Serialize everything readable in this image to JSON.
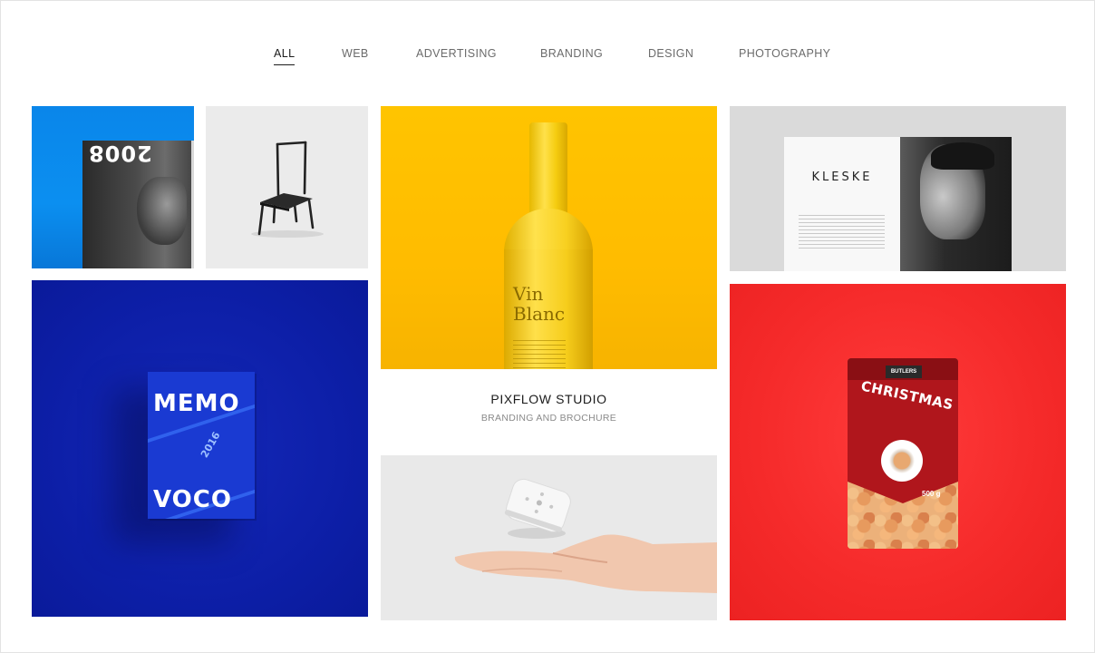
{
  "filters": [
    {
      "label": "ALL",
      "active": true
    },
    {
      "label": "WEB",
      "active": false
    },
    {
      "label": "ADVERTISING",
      "active": false
    },
    {
      "label": "BRANDING",
      "active": false
    },
    {
      "label": "DESIGN",
      "active": false
    },
    {
      "label": "PHOTOGRAPHY",
      "active": false
    }
  ],
  "portfolio": {
    "items": [
      {
        "image": "magazine-2008-cover",
        "cover_text": "2008"
      },
      {
        "image": "black-chair"
      },
      {
        "image": "yellow-wine-bottle",
        "label_text": "Vin Blanc"
      },
      {
        "image": "book-spread",
        "title_text": "KLESKE"
      },
      {
        "image": "memo-voco-box",
        "cover_top": "MEMO",
        "cover_bottom": "VOCO",
        "cover_year": "2016"
      },
      {
        "image": "hand-with-device"
      },
      {
        "image": "christmas-pasta-bag",
        "bag_title": "CHRISTMAS",
        "bag_brand": "BUTLERS",
        "bag_weight": "500 g"
      }
    ],
    "hover_caption": {
      "title": "PIXFLOW STUDIO",
      "subtitle": "BRANDING AND BROCHURE"
    }
  },
  "colors": {
    "active_filter": "#1b1b1b",
    "inactive_filter": "#6b6b6b",
    "caption_subtitle": "#8a8a8a"
  }
}
